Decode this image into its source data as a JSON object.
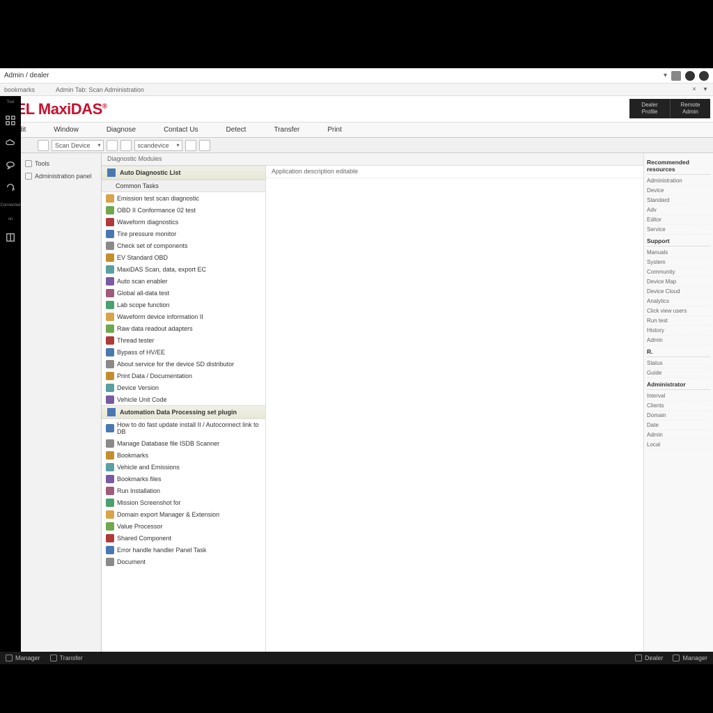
{
  "chrome": {
    "url_title": "Admin / dealer",
    "bookmark_bar": "bookmarks",
    "tab_label": "Admin Tab: Scan Administration"
  },
  "brand": {
    "text": "ITEL MaxiDAS",
    "reg": "®"
  },
  "header_box": {
    "left_top": "Dealer",
    "left_bot": "Profile",
    "right_top": "Remote",
    "right_bot": "Admin"
  },
  "menu": [
    "Edit",
    "Window",
    "Diagnose",
    "Contact Us",
    "Detect",
    "Transfer",
    "Print"
  ],
  "toolbar": {
    "sel1": "Scan Device",
    "sel2": "scandevice"
  },
  "leftnav": {
    "items": [
      "Tools",
      "Administration panel"
    ]
  },
  "rail_labels": [
    "Tool",
    "",
    "",
    "",
    "",
    "Connected",
    "on",
    ""
  ],
  "mainpanel": {
    "breadcrumb": "Diagnostic Modules",
    "section_a": "Auto Diagnostic List",
    "group1": "Common Tasks",
    "items1": [
      "Emission test scan diagnostic",
      "OBD II Conformance 02 test",
      "Waveform diagnostics",
      "Tire pressure monitor",
      "Check set of components",
      "EV Standard OBD",
      "MaxiDAS Scan, data, export EC",
      "Auto scan enabler",
      "Global all-data test",
      "Lab scope function",
      "Waveform device information II",
      "Raw data readout adapters",
      "Thread tester",
      "Bypass of HV/EE",
      "About service for the device SD distributor",
      "Print Data / Documentation",
      "Device Version",
      "Vehicle Unit Code"
    ],
    "group2": "Automation Data Processing set plugin",
    "items2": [
      "How to do fast update install II / Autoconnect link to DB",
      "Manage Database file ISDB Scanner",
      "Bookmarks",
      "Vehicle and Emissions",
      "Bookmarks files",
      "Run Installation",
      "Mission Screenshot for",
      "Domain export Manager & Extension",
      "Value Processor",
      "Shared Component",
      "Error handle handler Panel Task",
      "Document"
    ],
    "detail_header": "Application description editable"
  },
  "rside": {
    "heading1": "Recommended resources",
    "links1": [
      "Administration",
      "Device",
      "Standard",
      "Adv",
      "Editor",
      "Service"
    ],
    "heading2": "Support",
    "links2": [
      "Manuals",
      "System",
      "Community",
      "Device Map",
      "Device Cloud",
      "Analytics",
      "Click view users",
      "Run test",
      "History",
      "Admin"
    ],
    "heading3": "R.",
    "links3": [
      "Status",
      "Guide"
    ],
    "heading4": "Administrator",
    "links4": [
      "Interval",
      "Clients",
      "Domain",
      "Date",
      "Admin",
      "Local"
    ]
  },
  "status": {
    "left": [
      "Manager",
      "Transfer"
    ],
    "right": [
      "Dealer",
      "Manager"
    ]
  }
}
